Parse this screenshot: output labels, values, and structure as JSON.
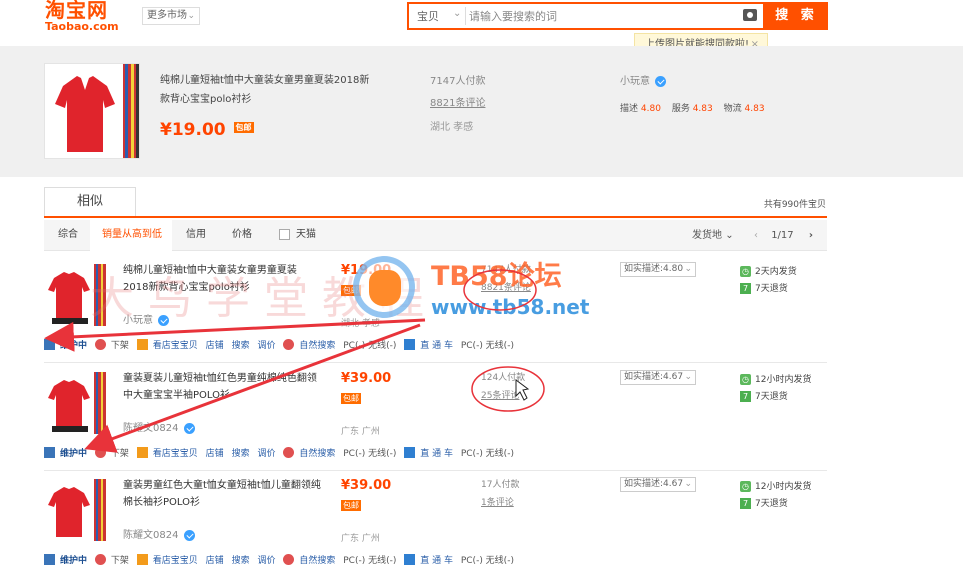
{
  "header": {
    "logo_cn": "淘宝网",
    "logo_en": "Taobao.com",
    "market": "更多市场",
    "search_scope": "宝贝",
    "search_placeholder": "请输入要搜索的词",
    "search_button": "搜 索",
    "tip": "上传图片就能搜同款啦!"
  },
  "summary": {
    "title": "纯棉儿童短袖t恤中大童装女童男童夏装2018新款背心宝宝polo衬衫",
    "price": "¥19.00",
    "badge": "包邮",
    "paid": "7147人付款",
    "reviews": "8821条评论",
    "location": "湖北 孝感",
    "shop": "小玩意",
    "score_labels": [
      "描述",
      "服务",
      "物流"
    ],
    "score_values": [
      "4.80",
      "4.83",
      "4.83"
    ]
  },
  "tabs": {
    "similar": "相似",
    "total": "共有990件宝贝"
  },
  "filter": {
    "sorts": [
      "综合",
      "销量从高到低",
      "信用",
      "价格"
    ],
    "tmall": "天猫",
    "ship_from": "发货地",
    "page": "1/17"
  },
  "results": [
    {
      "title": "纯棉儿童短袖t恤中大童装女童男童夏装2018新款背心宝宝polo衬衫",
      "shop": "小玩意",
      "price": "¥19.00",
      "badge": "包邮",
      "location": "湖北 孝感",
      "paid": "7147人付款",
      "reviews": "8821条评论",
      "rating": "如实描述:4.80",
      "svc1": "2天内发货",
      "svc2": "7天退货"
    },
    {
      "title": "童装夏装儿童短袖t恤红色男童纯棉纯色翻领中大童宝宝半袖POLO衫",
      "shop": "陈耀文0824",
      "price": "¥39.00",
      "badge": "包邮",
      "location": "广东 广州",
      "paid": "124人付款",
      "reviews": "25条评论",
      "rating": "如实描述:4.67",
      "svc1": "12小时内发货",
      "svc2": "7天退货"
    },
    {
      "title": "童装男童红色大童t恤女童短袖t恤儿童翻领纯棉长袖衫POLO衫",
      "shop": "陈耀文0824",
      "price": "¥39.00",
      "badge": "包邮",
      "location": "广东 广州",
      "paid": "17人付款",
      "reviews": "1条评论",
      "rating": "如实描述:4.67",
      "svc1": "12小时内发货",
      "svc2": "7天退货"
    }
  ],
  "tools": {
    "maintain": "维护中",
    "offline": "下架",
    "view_shop": "看店宝宝贝",
    "shop": "店铺",
    "search": "搜索",
    "adjust": "调价",
    "natural": "自然搜索",
    "pc_mobile": "PC(-) 无线(-)",
    "direct": "直 通 车"
  },
  "overlays": {
    "watermark": "大鸟学堂教程",
    "brand": "TB58论坛",
    "url": "www.tb58.net"
  }
}
